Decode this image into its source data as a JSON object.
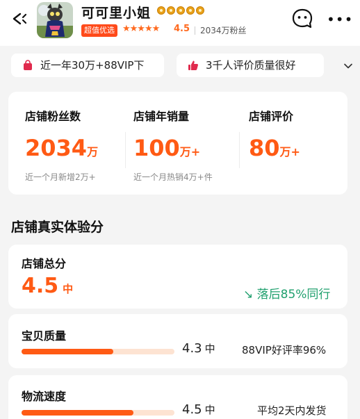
{
  "header": {
    "shop_name": "可可里小姐",
    "badge": "超值优选",
    "stars": "★★★★★",
    "rating": "4.5",
    "fans": "2034万粉丝"
  },
  "tags": [
    {
      "label": "近一年30万+88VIP下",
      "icon": "shopping-bag-icon"
    },
    {
      "label": "3千人评价质量很好",
      "icon": "thumbs-up-icon"
    }
  ],
  "stats": [
    {
      "title": "店铺粉丝数",
      "value": "2034",
      "unit": "万",
      "sub": "近一个月新增2万+"
    },
    {
      "title": "店铺年销量",
      "value": "100",
      "unit": "万+",
      "sub": "近一个月热销4万+件"
    },
    {
      "title": "店铺评价",
      "value": "80",
      "unit": "万+",
      "sub": ""
    }
  ],
  "section_title": "店铺真实体验分",
  "overall": {
    "title": "店铺总分",
    "score": "4.5",
    "level": "中",
    "compare": "↘ 落后85%同行"
  },
  "metrics": [
    {
      "title": "宝贝质量",
      "score": "4.3",
      "level": "中",
      "fill": 0.6,
      "side": "88VIP好评率96%"
    },
    {
      "title": "物流速度",
      "score": "4.5",
      "level": "中",
      "fill": 0.73,
      "side": "平均2天内发货"
    }
  ],
  "colors": {
    "accent": "#ff5a14",
    "track": "#fde3d2",
    "positive": "#20a06e"
  }
}
